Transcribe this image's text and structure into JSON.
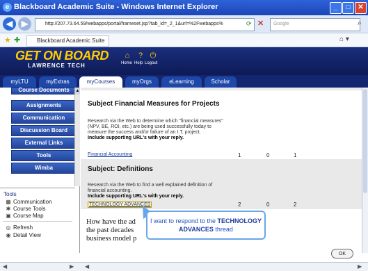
{
  "window": {
    "title": "Blackboard Academic Suite - Windows Internet Explorer"
  },
  "browser": {
    "address": "http://207.73.64.59/webapps/portal/frameset.jsp?tab_id=_2_1&url=%2Fwebapps%",
    "search_placeholder": "Google",
    "favorite_tab": "Blackboard Academic Suite"
  },
  "header": {
    "logo_line1": "GET ON BOARD",
    "logo_line2": "LAWRENCE TECH",
    "links": [
      "Home",
      "Help",
      "Logout"
    ]
  },
  "tabs": [
    {
      "label": "myLTU",
      "active": false
    },
    {
      "label": "myExtras",
      "active": false
    },
    {
      "label": "myCourses",
      "active": true
    },
    {
      "label": "myOrgs",
      "active": false
    },
    {
      "label": "eLearning",
      "active": false
    },
    {
      "label": "Scholar",
      "active": false
    }
  ],
  "sidebar": {
    "buttons": [
      "Course Documents",
      "Assignments",
      "Communication",
      "Discussion Board",
      "External Links",
      "Tools",
      "Wimba"
    ],
    "tools_title": "Tools",
    "tools": [
      "Communication",
      "Course Tools",
      "Course Map",
      "Refresh",
      "Detail View"
    ]
  },
  "main": {
    "section1": {
      "title": "Subject Financial Measures for Projects",
      "body": "Research via the Web to determine which \"financial measures\" (NPV, BE, ROI, etc.) are being used successfully today to measure the success and/or failure of an I.T. project.",
      "note": "Include supporting URL's with your reply.",
      "link": "Financial Accounting",
      "counts": [
        "1",
        "0",
        "1"
      ]
    },
    "section2": {
      "title": "Subject: Definitions",
      "body": "Research via the Web to find a well explained definition of financial accounting.",
      "note": "Include supporting URL's with your reply.",
      "link": "TECHNOLOGY ADVANCES",
      "counts": [
        "2",
        "0",
        "2"
      ]
    },
    "preview_lines": [
      "How have the ad",
      "the past decades",
      "business model p"
    ]
  },
  "callout": {
    "text_pre": "I want to respond to the",
    "text_strong1": "TECHNOLOGY",
    "text_strong2": "ADVANCES",
    "text_post": "thread"
  },
  "ok_label": "OK"
}
